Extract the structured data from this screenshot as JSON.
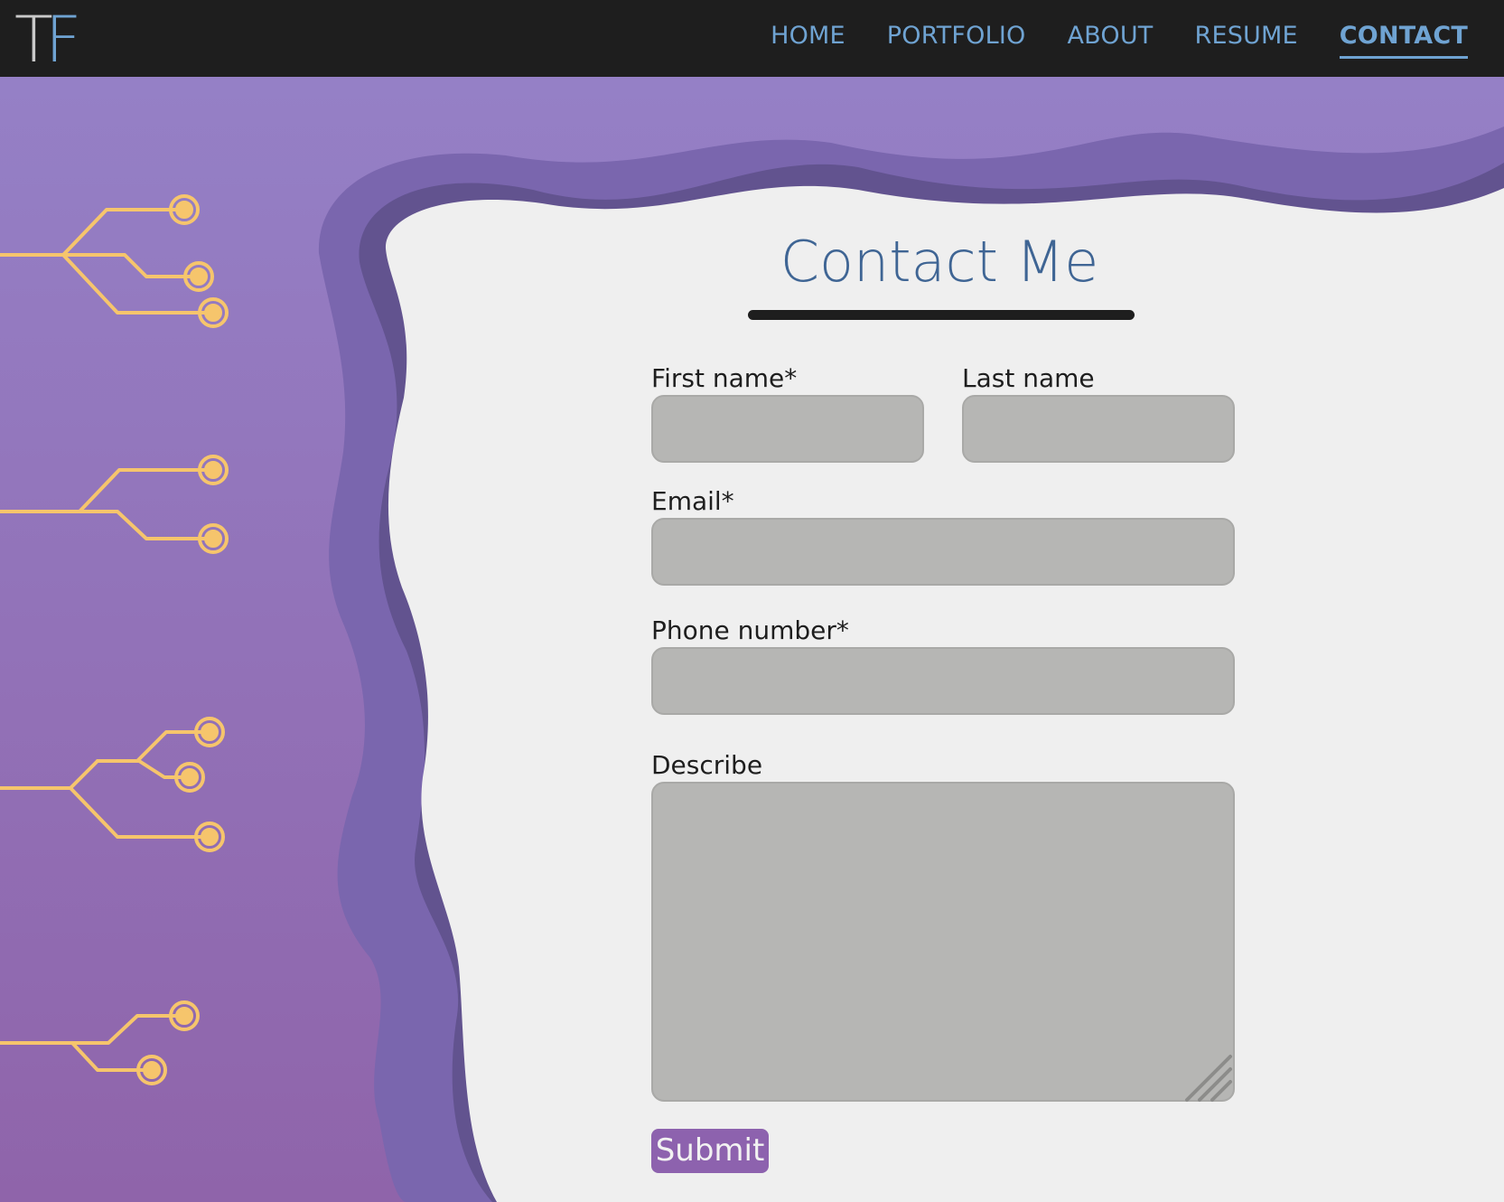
{
  "logo": {
    "letter1": "T",
    "letter2": "F"
  },
  "nav": {
    "items": [
      {
        "label": "HOME",
        "active": false
      },
      {
        "label": "PORTFOLIO",
        "active": false
      },
      {
        "label": "ABOUT",
        "active": false
      },
      {
        "label": "RESUME",
        "active": false
      },
      {
        "label": "CONTACT",
        "active": true
      }
    ]
  },
  "form": {
    "title": "Contact Me",
    "first_name_label": "First name*",
    "first_name_value": "",
    "last_name_label": "Last name",
    "last_name_value": "",
    "email_label": "Email*",
    "email_value": "",
    "phone_label": "Phone number*",
    "phone_value": "",
    "describe_label": "Describe",
    "describe_value": "",
    "submit_label": "Submit"
  },
  "colors": {
    "nav_bg": "#1e1e1e",
    "accent_blue": "#6fa3d2",
    "title_blue": "#3f6594",
    "purple_bg": "#9280c6",
    "purple_wave_mid": "#7a66ae",
    "purple_wave_dark": "#62538f",
    "circuit_gold": "#f6c56c",
    "field_gray": "#b6b6b4",
    "page_bg": "#efefef",
    "submit_purple": "#8d62ae"
  },
  "decor": {
    "icons": [
      "circuit-trace-icon"
    ]
  }
}
